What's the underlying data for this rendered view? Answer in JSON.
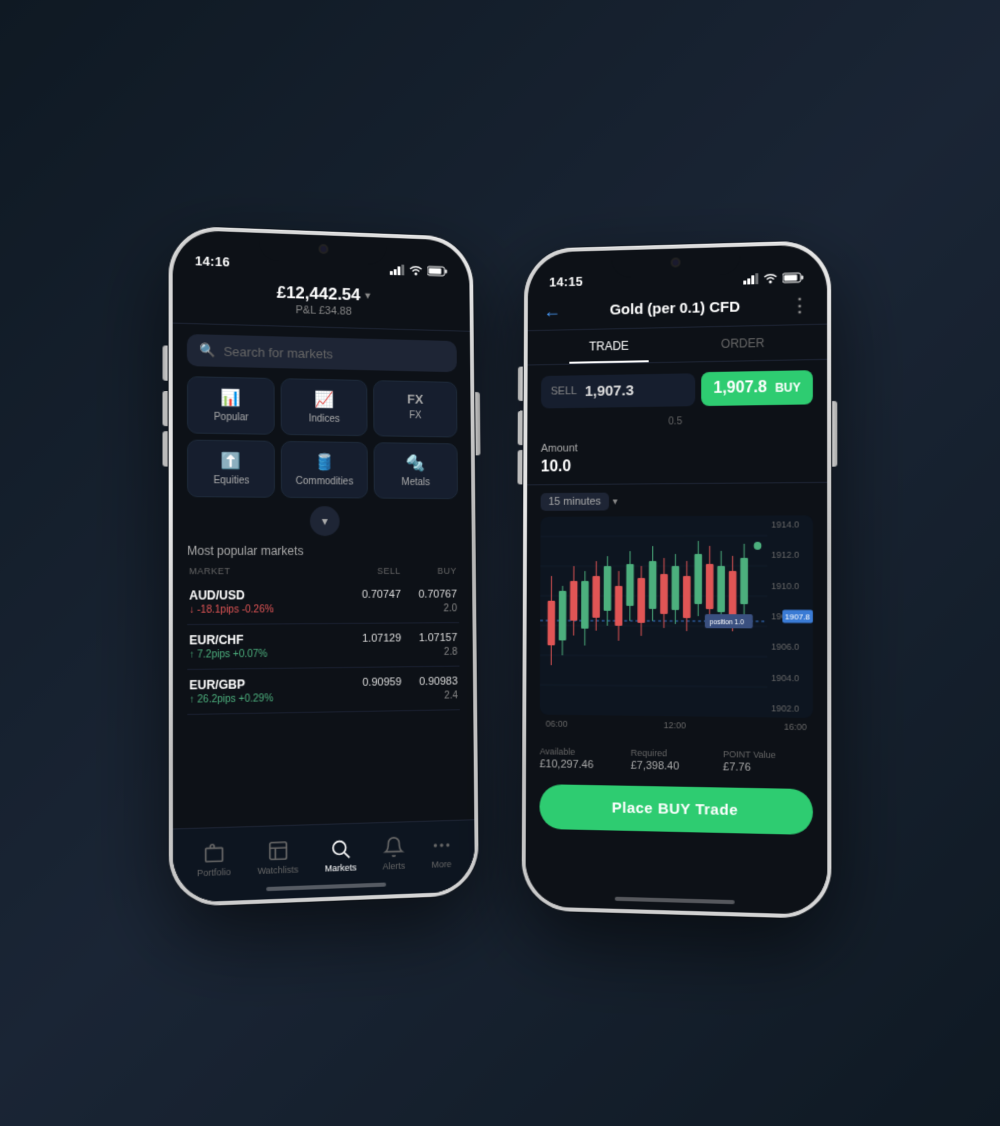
{
  "phone1": {
    "statusTime": "14:16",
    "balance": "£12,442.54",
    "pnl": "P&L £34.88",
    "searchPlaceholder": "Search for markets",
    "categories": [
      {
        "label": "Popular",
        "icon": "📊"
      },
      {
        "label": "Indices",
        "icon": "📈"
      },
      {
        "label": "FX",
        "icon": "FX"
      },
      {
        "label": "Equities",
        "icon": "⬆️"
      },
      {
        "label": "Commodities",
        "icon": "🛢️"
      },
      {
        "label": "Metals",
        "icon": "🔩"
      }
    ],
    "marketsTitle": "Most popular markets",
    "marketsHeaders": [
      "MARKET",
      "SELL",
      "BUY"
    ],
    "markets": [
      {
        "name": "AUD/USD",
        "sell": "0.70747",
        "buy": "0.70767",
        "change": "↓ -18.1pips -0.26%",
        "spread": "2.0",
        "negative": true
      },
      {
        "name": "EUR/CHF",
        "sell": "1.07129",
        "buy": "1.07157",
        "change": "↑ 7.2pips +0.07%",
        "spread": "2.8",
        "negative": false
      },
      {
        "name": "EUR/GBP",
        "sell": "0.90959",
        "buy": "0.90983",
        "change": "↑ 26.2pips +0.29%",
        "spread": "2.4",
        "negative": false
      }
    ],
    "nav": [
      {
        "label": "Portfolio",
        "icon": "📁",
        "active": false
      },
      {
        "label": "Watchlists",
        "icon": "📋",
        "active": false
      },
      {
        "label": "Markets",
        "icon": "🔍",
        "active": true
      },
      {
        "label": "Alerts",
        "icon": "🔔",
        "active": false
      },
      {
        "label": "More",
        "icon": "⋯",
        "active": false
      }
    ]
  },
  "phone2": {
    "statusTime": "14:15",
    "title": "Gold (per 0.1) CFD",
    "tabs": [
      "TRADE",
      "ORDER"
    ],
    "activeTab": "TRADE",
    "sellLabel": "SELL",
    "sellPrice": "1,907.3",
    "buyPrice": "1,907.8",
    "buyLabel": "BUY",
    "spread": "0.5",
    "amountLabel": "Amount",
    "amountValue": "10.0",
    "timeframe": "15 minutes",
    "chartPrices": {
      "high": "1914.0",
      "mid1": "1912.0",
      "mid2": "1910.0",
      "mid3": "1908.0",
      "low1": "1906.0",
      "low2": "1904.0",
      "low3": "1902.0"
    },
    "chartTimes": [
      "06:00",
      "12:00",
      "16:00"
    ],
    "positionLabel": "position 1.0",
    "priceLine1": "1907.8",
    "priceLine2": "1907.8",
    "priceLine3": "1906.0",
    "info": [
      {
        "label": "Available",
        "value": "£10,297.46"
      },
      {
        "label": "Required",
        "value": "£7,398.40"
      },
      {
        "label": "POINT Value",
        "value": "£7.76"
      }
    ],
    "placeTradeBtn": "Place BUY Trade"
  }
}
